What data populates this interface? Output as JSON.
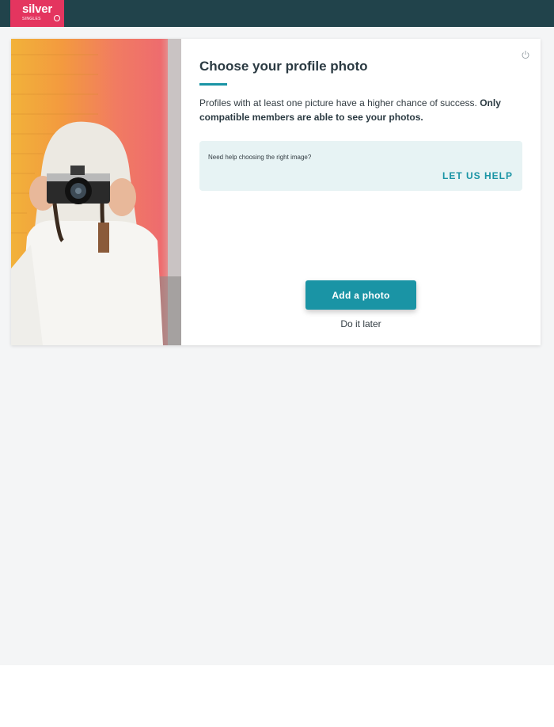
{
  "header": {
    "logo_brand": "silver",
    "logo_sub": "SINGLES",
    "colors": {
      "bar": "#21434b",
      "logo": "#e4355f"
    }
  },
  "card": {
    "photo_icon": "woman-with-camera-photo",
    "close_icon": "power-icon",
    "title": "Choose your profile photo",
    "description_regular": "Profiles with at least one picture have a higher chance of success. ",
    "description_bold": "Only compatible members are able to see your photos.",
    "help": {
      "question": "Need help choosing the right image?",
      "cta": "LET US HELP"
    },
    "primary_button": "Add a photo",
    "secondary_link": "Do it later",
    "accent_color": "#1a94a5"
  }
}
